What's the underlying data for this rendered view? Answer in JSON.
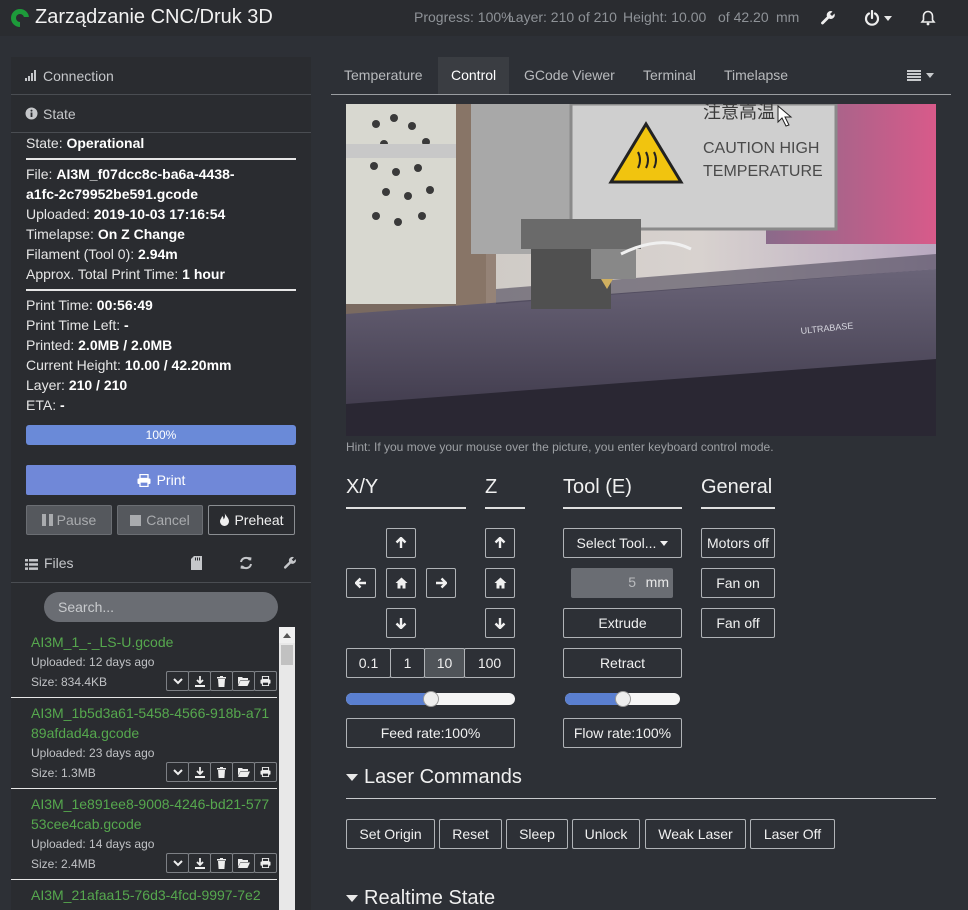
{
  "navbar": {
    "brand": "Zarządzanie CNC/Druk 3D",
    "progress": "Progress: 100%",
    "layer_status": "Layer: 210 of 210",
    "height_status": "Height: 10.00",
    "height_total": "of 42.20",
    "height_unit": "mm"
  },
  "sidebar": {
    "connection_label": "Connection",
    "state_label": "State",
    "state": {
      "label": "State:",
      "value": "Operational"
    },
    "file": {
      "label": "File:",
      "value_line1": "AI3M_f07dcc8c-ba6a-4438-",
      "value_line2": "a1fc-2c79952be591.gcode"
    },
    "uploaded": {
      "label": "Uploaded:",
      "value": "2019-10-03 17:16:54"
    },
    "timelapse": {
      "label": "Timelapse:",
      "value": "On Z Change"
    },
    "filament": {
      "label": "Filament (Tool 0):",
      "value": "2.94m"
    },
    "approx": {
      "label": "Approx. Total Print Time:",
      "value": "1 hour"
    },
    "print_time": {
      "label": "Print Time:",
      "value": "00:56:49"
    },
    "time_left": {
      "label": "Print Time Left:",
      "value": "-"
    },
    "printed": {
      "label": "Printed:",
      "value": "2.0MB / 2.0MB"
    },
    "current_height": {
      "label": "Current Height:",
      "value": "10.00 / 42.20mm"
    },
    "layer": {
      "label": "Layer:",
      "value": "210 / 210"
    },
    "eta": {
      "label": "ETA:",
      "value": "-"
    },
    "progress_text": "100%",
    "progress_value": 1.0,
    "buttons": {
      "print": "Print",
      "pause": "Pause",
      "cancel": "Cancel",
      "preheat": "Preheat"
    },
    "files_label": "Files",
    "search_placeholder": "Search...",
    "files": [
      {
        "name": "AI3M_1_-_LS-U.gcode",
        "uploaded": "Uploaded: 12 days ago",
        "size": "Size: 834.4KB"
      },
      {
        "name": "AI3M_1b5d3a61-5458-4566-918b-a7189afdad4a.gcode",
        "uploaded": "Uploaded: 23 days ago",
        "size": "Size: 1.3MB"
      },
      {
        "name": "AI3M_1e891ee8-9008-4246-bd21-57753cee4cab.gcode",
        "uploaded": "Uploaded: 14 days ago",
        "size": "Size: 2.4MB"
      },
      {
        "name": "AI3M_21afaa15-76d3-4fcd-9997-7e2",
        "uploaded": "",
        "size": ""
      }
    ]
  },
  "tabs": [
    "Temperature",
    "Control",
    "GCode Viewer",
    "Terminal",
    "Timelapse"
  ],
  "active_tab": "Control",
  "hint": "Hint: If you move your mouse over the picture, you enter keyboard control mode.",
  "control": {
    "xy_title": "X/Y",
    "z_title": "Z",
    "tool_title": "Tool (E)",
    "general_title": "General",
    "distances": [
      "0.1",
      "1",
      "10",
      "100"
    ],
    "selected_distance": "10",
    "feed_rate": "Feed rate:100%",
    "feed_value": 0.5,
    "flow_rate": "Flow rate:100%",
    "flow_value": 0.5,
    "select_tool": "Select Tool...",
    "extrude_amount": "5",
    "extrude_unit": "mm",
    "extrude": "Extrude",
    "retract": "Retract",
    "motors_off": "Motors off",
    "fan_on": "Fan on",
    "fan_off": "Fan off"
  },
  "laser": {
    "title": "Laser Commands",
    "buttons": [
      "Set Origin",
      "Reset",
      "Sleep",
      "Unlock",
      "Weak Laser",
      "Laser Off"
    ]
  },
  "realtime": {
    "title": "Realtime State"
  },
  "webcam": {
    "sign_line1": "注意高温",
    "sign_line2": "CAUTION HIGH",
    "sign_line3": "TEMPERATURE"
  },
  "colors": {
    "accent": "#7088d8",
    "file_link": "#56a84e",
    "background": "#2d3036",
    "panel": "#2a2c30"
  }
}
